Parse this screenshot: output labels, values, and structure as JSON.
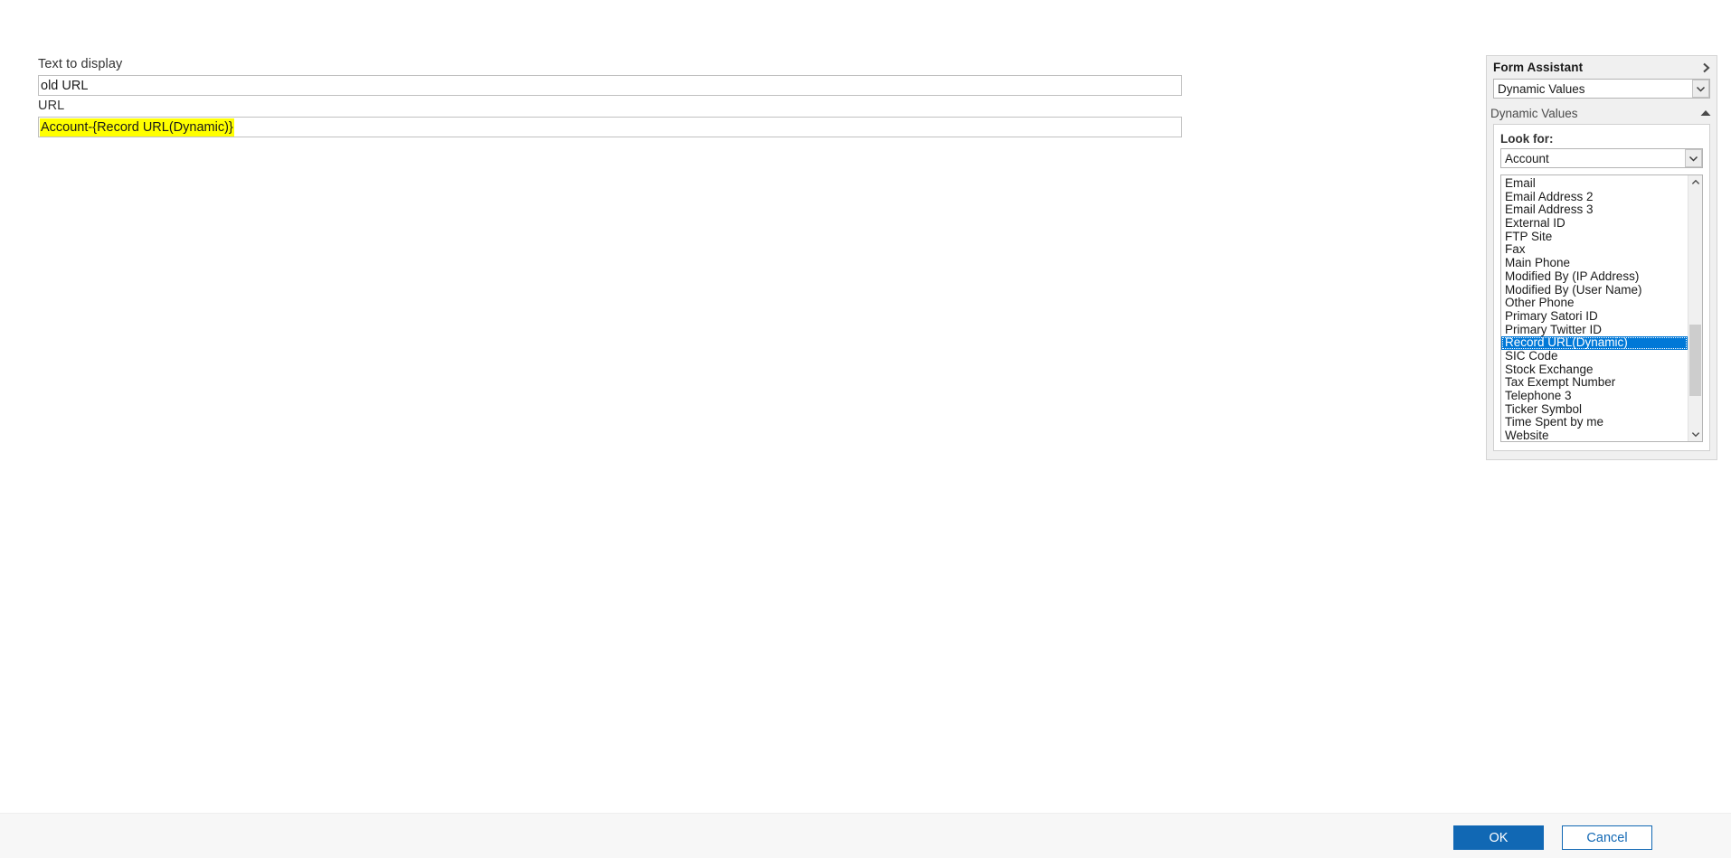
{
  "dialog": {
    "fields": [
      {
        "label": "Text to display",
        "value": "old URL",
        "placeholder": ""
      },
      {
        "label": "URL",
        "value": "Account-{Record URL(Dynamic)}",
        "placeholder": ""
      }
    ],
    "highlight_color": "#ffff00"
  },
  "form_assistant": {
    "title": "Form Assistant",
    "expand_icon": "chevron-right-icon",
    "mode_select": {
      "value": "Dynamic Values",
      "dropdown_icon": "chevron-down-icon"
    },
    "section": {
      "title": "Dynamic Values",
      "collapse_icon": "triangle-up-icon"
    },
    "look_for": {
      "label": "Look for:",
      "value": "Account",
      "dropdown_icon": "chevron-down-icon"
    },
    "field_list": {
      "items": [
        "Email",
        "Email Address 2",
        "Email Address 3",
        "External ID",
        "FTP Site",
        "Fax",
        "Main Phone",
        "Modified By (IP Address)",
        "Modified By (User Name)",
        "Other Phone",
        "Primary Satori ID",
        "Primary Twitter ID",
        "Record URL(Dynamic)",
        "SIC Code",
        "Stock Exchange",
        "Tax Exempt Number",
        "Telephone 3",
        "Ticker Symbol",
        "Time Spent by me",
        "Website"
      ],
      "selected_index": 12,
      "selection_color": "#0078d7",
      "scrollbar": {
        "up_icon": "chevron-up-icon",
        "down_icon": "chevron-down-icon",
        "thumb_top_pct": 57,
        "thumb_height_pct": 30
      }
    }
  },
  "actions": {
    "ok_label": "OK",
    "cancel_label": "Cancel",
    "accent_color": "#1168b4"
  }
}
